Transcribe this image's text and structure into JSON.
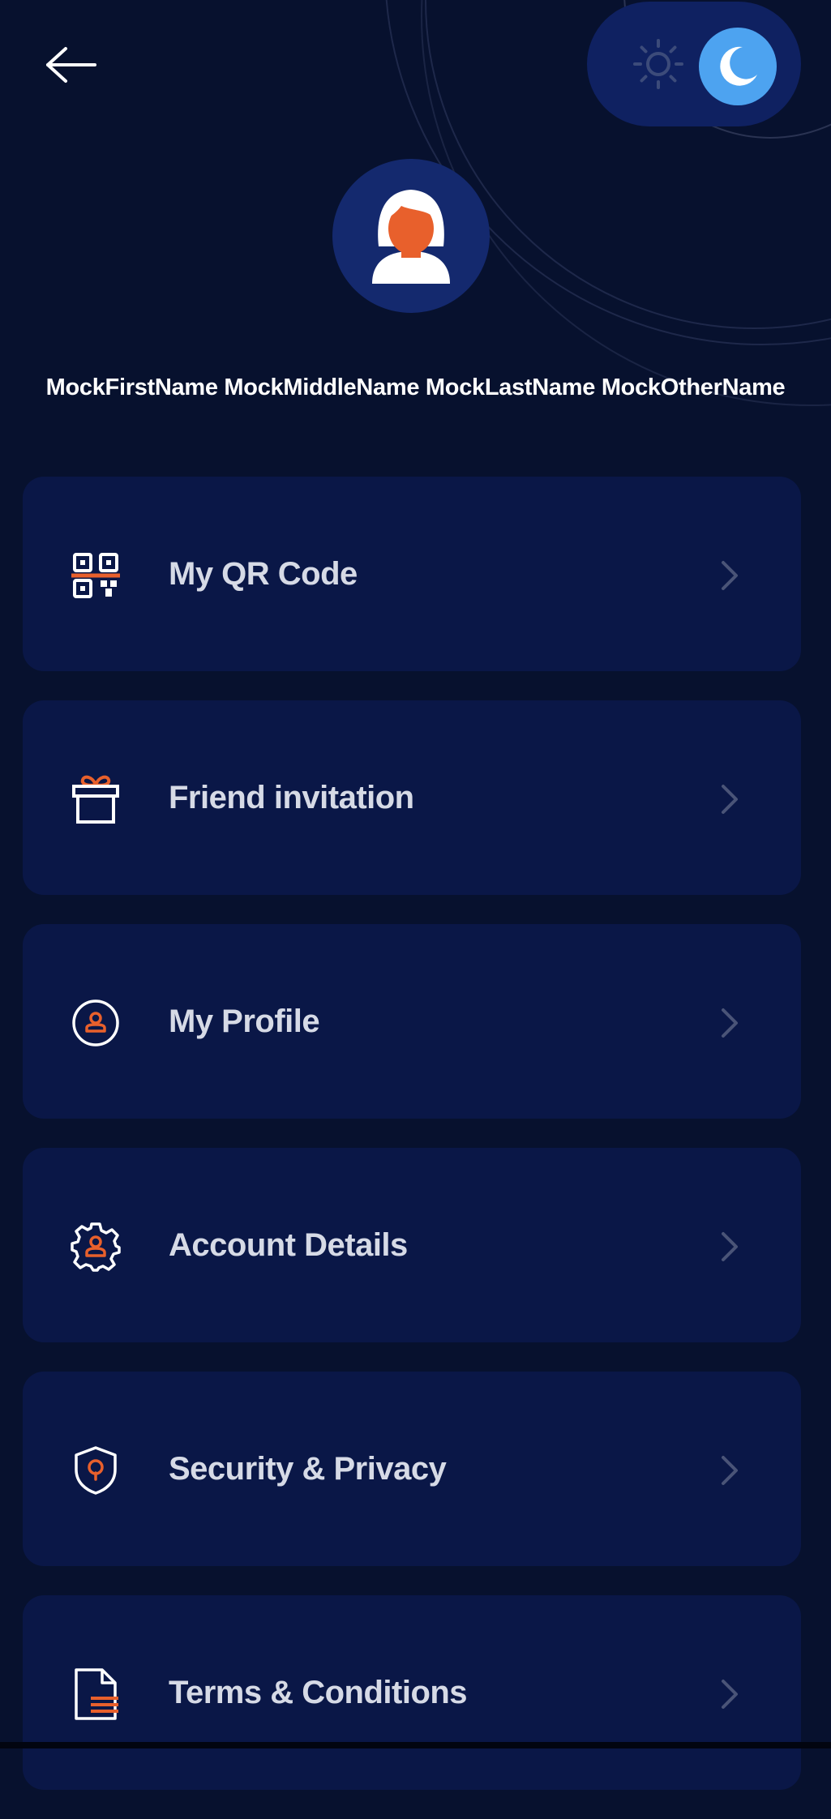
{
  "header": {
    "back_icon": "arrow-left-icon",
    "theme_toggle": {
      "light_icon": "sun-icon",
      "dark_icon": "moon-icon",
      "active": "dark"
    }
  },
  "profile": {
    "avatar_icon": "user-avatar-icon",
    "name": "MockFirstName MockMiddleName MockLastName MockOtherName"
  },
  "menu": {
    "items": [
      {
        "label": "My QR Code",
        "icon": "qr-code-icon"
      },
      {
        "label": "Friend invitation",
        "icon": "gift-icon"
      },
      {
        "label": "My Profile",
        "icon": "user-circle-icon"
      },
      {
        "label": "Account Details",
        "icon": "gear-user-icon"
      },
      {
        "label": "Security & Privacy",
        "icon": "shield-lock-icon"
      },
      {
        "label": "Terms & Conditions",
        "icon": "document-icon"
      }
    ]
  },
  "colors": {
    "background": "#07112e",
    "card": "#0a1747",
    "accent_orange": "#e8602c",
    "accent_blue": "#4da3f0",
    "text": "#d6dae6"
  }
}
